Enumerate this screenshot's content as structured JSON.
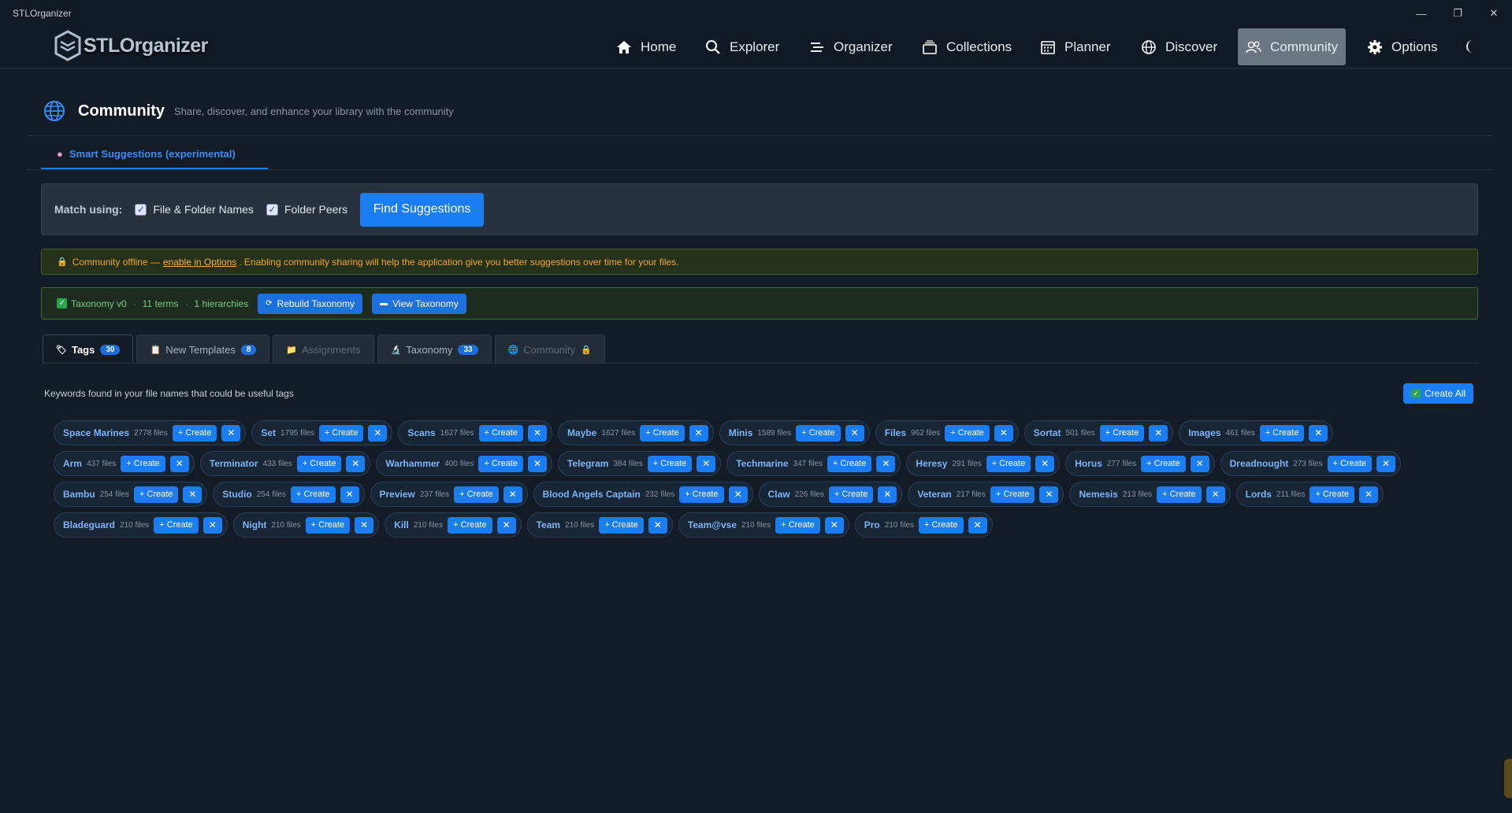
{
  "window": {
    "title": "STLOrganizer",
    "minimize": "—",
    "maximize": "❐",
    "close": "✕"
  },
  "nav": {
    "brand": "STLOrganizer",
    "items": [
      {
        "label": "Home",
        "icon": "home-icon"
      },
      {
        "label": "Explorer",
        "icon": "search-icon"
      },
      {
        "label": "Organizer",
        "icon": "organizer-icon"
      },
      {
        "label": "Collections",
        "icon": "collections-icon"
      },
      {
        "label": "Planner",
        "icon": "calendar-icon"
      },
      {
        "label": "Discover",
        "icon": "globe-icon"
      },
      {
        "label": "Community",
        "icon": "users-icon",
        "active": true
      },
      {
        "label": "Options",
        "icon": "gear-icon"
      }
    ]
  },
  "page": {
    "title": "Community",
    "subtitle": "Share, discover, and enhance your library with the community",
    "main_tab": "Smart Suggestions (experimental)"
  },
  "match": {
    "label": "Match using:",
    "option1": "File & Folder Names",
    "option2": "Folder Peers",
    "find_button": "Find Suggestions"
  },
  "warning": {
    "prefix": "Community offline —",
    "link": "enable in Options",
    "suffix": ". Enabling community sharing will help the application give you better suggestions over time for your files."
  },
  "taxonomy": {
    "version": "Taxonomy v0",
    "terms": "11 terms",
    "hierarchies": "1 hierarchies",
    "rebuild_button": "Rebuild Taxonomy",
    "view_button": "View Taxonomy"
  },
  "subtabs": [
    {
      "label": "Tags",
      "count": "30",
      "icon": "🏷"
    },
    {
      "label": "New Templates",
      "count": "8",
      "icon": "📋"
    },
    {
      "label": "Assignments",
      "count": "",
      "icon": "📁"
    },
    {
      "label": "Taxonomy",
      "count": "33",
      "icon": "🔬"
    },
    {
      "label": "Community",
      "count": "",
      "icon": "🌐"
    }
  ],
  "tags": {
    "hint": "Keywords found in your file names that could be useful tags",
    "create_all": "Create All",
    "create_label": "+ Create",
    "dismiss_label": "✕",
    "items": [
      {
        "name": "Space Marines",
        "files": "2778 files"
      },
      {
        "name": "Set",
        "files": "1795 files"
      },
      {
        "name": "Scans",
        "files": "1627 files"
      },
      {
        "name": "Maybe",
        "files": "1627 files"
      },
      {
        "name": "Minis",
        "files": "1589 files"
      },
      {
        "name": "Files",
        "files": "962 files"
      },
      {
        "name": "Sortat",
        "files": "501 files"
      },
      {
        "name": "Images",
        "files": "461 files"
      },
      {
        "name": "Arm",
        "files": "437 files"
      },
      {
        "name": "Terminator",
        "files": "433 files"
      },
      {
        "name": "Warhammer",
        "files": "400 files"
      },
      {
        "name": "Telegram",
        "files": "384 files"
      },
      {
        "name": "Techmarine",
        "files": "347 files"
      },
      {
        "name": "Heresy",
        "files": "291 files"
      },
      {
        "name": "Horus",
        "files": "277 files"
      },
      {
        "name": "Dreadnought",
        "files": "273 files"
      },
      {
        "name": "Bambu",
        "files": "254 files"
      },
      {
        "name": "Studio",
        "files": "254 files"
      },
      {
        "name": "Preview",
        "files": "237 files"
      },
      {
        "name": "Blood Angels Captain",
        "files": "232 files"
      },
      {
        "name": "Claw",
        "files": "226 files"
      },
      {
        "name": "Veteran",
        "files": "217 files"
      },
      {
        "name": "Nemesis",
        "files": "213 files"
      },
      {
        "name": "Lords",
        "files": "211 files"
      },
      {
        "name": "Bladeguard",
        "files": "210 files"
      },
      {
        "name": "Night",
        "files": "210 files"
      },
      {
        "name": "Kill",
        "files": "210 files"
      },
      {
        "name": "Team",
        "files": "210 files"
      },
      {
        "name": "Team@vse",
        "files": "210 files"
      },
      {
        "name": "Pro",
        "files": "210 files"
      }
    ]
  }
}
